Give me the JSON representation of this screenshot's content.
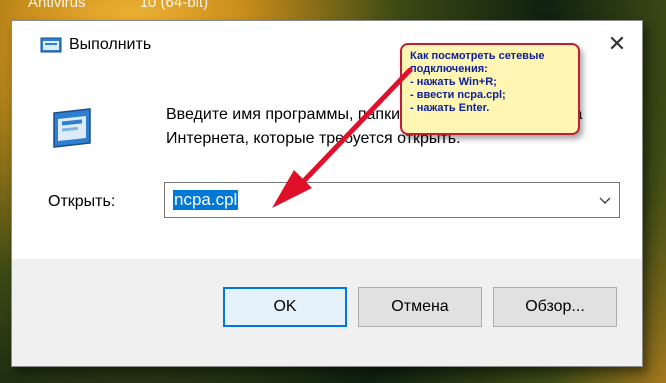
{
  "background": {
    "texts": [
      "Antivirus",
      "10 (64-bit)"
    ]
  },
  "dialog": {
    "title": "Выполнить",
    "description": "Введите имя программы, папки, документа или ресурса Интернета, которые требуется открыть.",
    "open_label": "Открыть:",
    "input_value": "ncpa.cpl",
    "buttons": {
      "ok": "OK",
      "cancel": "Отмена",
      "browse": "Обзор..."
    },
    "close_symbol": "✕"
  },
  "callout": {
    "lines": [
      "Как посмотреть сетевые",
      "подключения:",
      "- нажать Win+R;",
      "- ввести ncpa.cpl;",
      "- нажать Enter."
    ]
  },
  "colors": {
    "accent": "#0078d7",
    "arrow": "#e0102a",
    "callout_bg": "#fff6b3",
    "callout_text": "#0c1f9a"
  },
  "icons": [
    "run-icon",
    "close-icon",
    "chevron-down-icon",
    "run-large-icon",
    "red-arrow"
  ]
}
